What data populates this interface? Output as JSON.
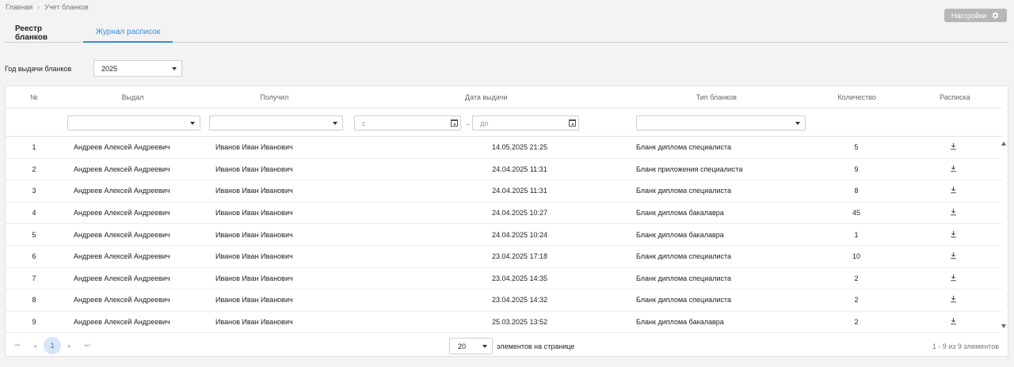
{
  "breadcrumb": {
    "home": "Главная",
    "separator": "›",
    "current": "Учет бланков"
  },
  "settings": {
    "label": "Настройки"
  },
  "tabs": [
    {
      "label": "Реестр бланков"
    },
    {
      "label": "Журнал расписок"
    }
  ],
  "year_filter": {
    "label": "Год выдачи бланков",
    "value": "2025"
  },
  "table": {
    "headers": {
      "num": "№",
      "issued": "Выдал",
      "received": "Получил",
      "date": "Дата выдачи",
      "type": "Тип бланков",
      "qty": "Количество",
      "receipt": "Расписка"
    },
    "filters": {
      "date_from_placeholder": "с",
      "date_to_placeholder": "до",
      "range_sep": "-"
    },
    "rows": [
      {
        "num": "1",
        "issued": "Андреев Алексей Андреевич",
        "received": "Иванов Иван Иванович",
        "date": "14.05.2025 21:25",
        "type": "Бланк диплома специалиста",
        "qty": "5"
      },
      {
        "num": "2",
        "issued": "Андреев Алексей Андреевич",
        "received": "Иванов Иван Иванович",
        "date": "24.04.2025 11:31",
        "type": "Бланк приложения специалиста",
        "qty": "9"
      },
      {
        "num": "3",
        "issued": "Андреев Алексей Андреевич",
        "received": "Иванов Иван Иванович",
        "date": "24.04.2025 11:31",
        "type": "Бланк диплома специалиста",
        "qty": "8"
      },
      {
        "num": "4",
        "issued": "Андреев Алексей Андреевич",
        "received": "Иванов Иван Иванович",
        "date": "24.04.2025 10:27",
        "type": "Бланк диплома бакалавра",
        "qty": "45"
      },
      {
        "num": "5",
        "issued": "Андреев Алексей Андреевич",
        "received": "Иванов Иван Иванович",
        "date": "24.04.2025 10:24",
        "type": "Бланк диплома бакалавра",
        "qty": "1"
      },
      {
        "num": "6",
        "issued": "Андреев Алексей Андреевич",
        "received": "Иванов Иван Иванович",
        "date": "23.04.2025 17:18",
        "type": "Бланк диплома специалиста",
        "qty": "10"
      },
      {
        "num": "7",
        "issued": "Андреев Алексей Андреевич",
        "received": "Иванов Иван Иванович",
        "date": "23.04.2025 14:35",
        "type": "Бланк диплома специалиста",
        "qty": "2"
      },
      {
        "num": "8",
        "issued": "Андреев Алексей Андреевич",
        "received": "Иванов Иван Иванович",
        "date": "23.04.2025 14:32",
        "type": "Бланк диплома специалиста",
        "qty": "2"
      },
      {
        "num": "9",
        "issued": "Андреев Алексей Андреевич",
        "received": "Иванов Иван Иванович",
        "date": "25.03.2025 13:52",
        "type": "Бланк диплома бакалавра",
        "qty": "2"
      }
    ]
  },
  "pager": {
    "current_page": "1",
    "per_page": "20",
    "per_page_label": "элементов на странице",
    "range_text": "1 - 9 из 9 элементов"
  },
  "colors": {
    "accent": "#3a8ad6",
    "settings_bg": "#b7b7b7",
    "page_bg": "#f3f3f3"
  },
  "icons": {
    "receipt": "download-icon",
    "settings": "gear-icon"
  }
}
